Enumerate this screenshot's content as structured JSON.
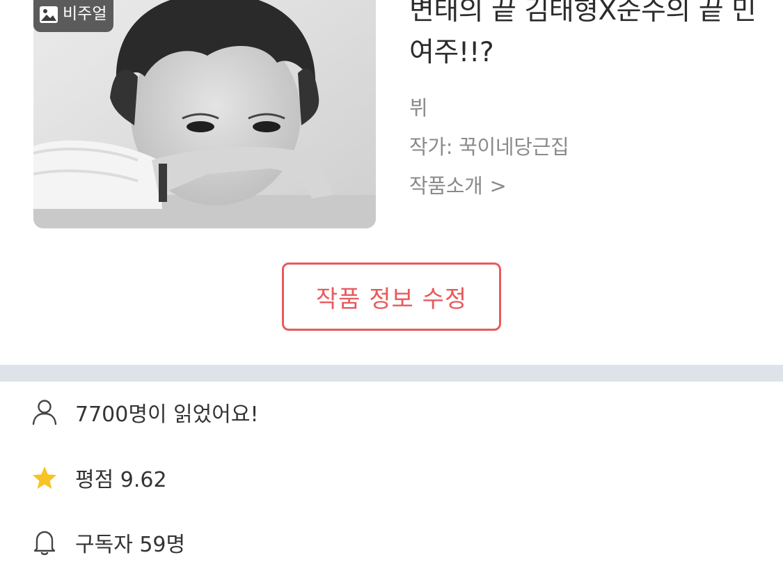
{
  "work": {
    "badge_label": "비주얼",
    "badge_icon": "image-icon",
    "title": "변태의 끝 김태형X순수의 끝 민여주!!?",
    "genre": "뷔",
    "author": "작가: 꾹이네당근집",
    "intro_link": "작품소개",
    "intro_chevron": ">"
  },
  "actions": {
    "edit_label": "작품 정보 수정"
  },
  "stats": {
    "views_text": "7700명이 읽었어요!",
    "views_icon": "person-icon",
    "rating_text": "평점 9.62",
    "rating_icon": "star-icon",
    "subscribers_text": "구독자 59명",
    "subscribers_icon": "bell-icon"
  },
  "colors": {
    "accent": "#e85a5c",
    "divider": "#dde3e8",
    "star": "#f7c325"
  }
}
